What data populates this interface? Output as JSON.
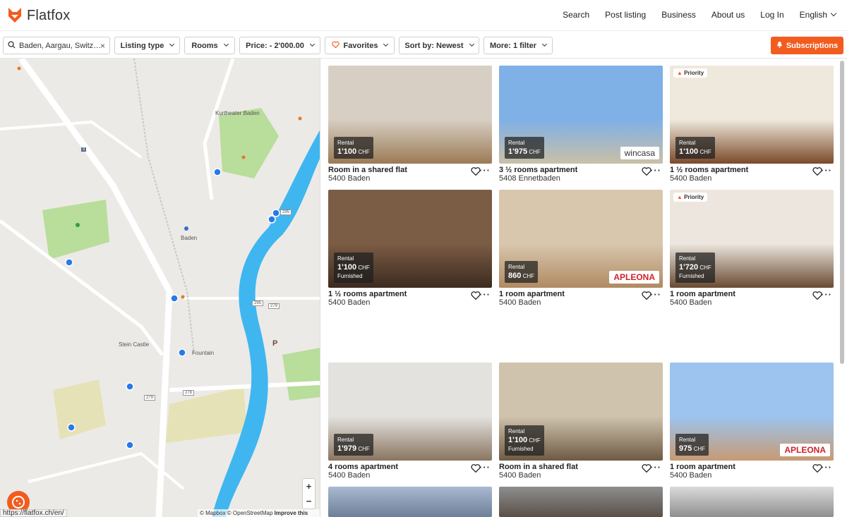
{
  "header": {
    "brand": "Flatfox",
    "nav": [
      "Search",
      "Post listing",
      "Business",
      "About us",
      "Log In"
    ],
    "language": "English"
  },
  "filters": {
    "search_value": "Baden, Aargau, Switz…",
    "listing_type": "Listing type",
    "rooms": "Rooms",
    "price": "Price: - 2'000.00",
    "favorites": "Favorites",
    "sort": "Sort by: Newest",
    "more": "More: 1 filter",
    "subscriptions": "Subscriptions"
  },
  "map": {
    "labels": [
      "Kurtheater Baden",
      "Baden",
      "Stein Castle",
      "Fountain",
      "P"
    ],
    "roads": [
      "3",
      "295",
      "279",
      "278",
      "295",
      "279"
    ],
    "zoom_in": "+",
    "zoom_out": "−",
    "attribution_1": "© Mapbox © OpenStreetMap",
    "attribution_2": "Improve this map",
    "url_hint": "https://flatfox.ch/en/"
  },
  "listings": [
    {
      "type": "Rental",
      "price": "1'100",
      "currency": "CHF",
      "extra": "",
      "title": "Room in a shared flat",
      "location": "5400 Baden",
      "priority": "",
      "brand": ""
    },
    {
      "type": "Rental",
      "price": "1'975",
      "currency": "CHF",
      "extra": "",
      "title": "3 ½ rooms apartment",
      "location": "5408 Ennetbaden",
      "priority": "",
      "brand": "wincasa"
    },
    {
      "type": "Rental",
      "price": "1'100",
      "currency": "CHF",
      "extra": "",
      "title": "1 ½ rooms apartment",
      "location": "5400 Baden",
      "priority": "Priority",
      "brand": ""
    },
    {
      "type": "Rental",
      "price": "1'100",
      "currency": "CHF",
      "extra": "Furnished",
      "title": "1 ½ rooms apartment",
      "location": "5400 Baden",
      "priority": "",
      "brand": ""
    },
    {
      "type": "Rental",
      "price": "860",
      "currency": "CHF",
      "extra": "",
      "title": "1 room apartment",
      "location": "5400 Baden",
      "priority": "",
      "brand": "APLEONA"
    },
    {
      "type": "Rental",
      "price": "1'720",
      "currency": "CHF",
      "extra": "Furnished",
      "title": "1 room apartment",
      "location": "5400 Baden",
      "priority": "Priority",
      "brand": ""
    },
    {
      "type": "Rental",
      "price": "1'979",
      "currency": "CHF",
      "extra": "",
      "title": "4 rooms apartment",
      "location": "5400 Baden",
      "priority": "",
      "brand": ""
    },
    {
      "type": "Rental",
      "price": "1'100",
      "currency": "CHF",
      "extra": "Furnished",
      "title": "Room in a shared flat",
      "location": "5400 Baden",
      "priority": "",
      "brand": ""
    },
    {
      "type": "Rental",
      "price": "975",
      "currency": "CHF",
      "extra": "",
      "title": "1 room apartment",
      "location": "5400 Baden",
      "priority": "",
      "brand": "APLEONA"
    }
  ],
  "colors": {
    "accent": "#f25c1f",
    "river": "#3fb6f0",
    "park": "#b9dd9a"
  }
}
